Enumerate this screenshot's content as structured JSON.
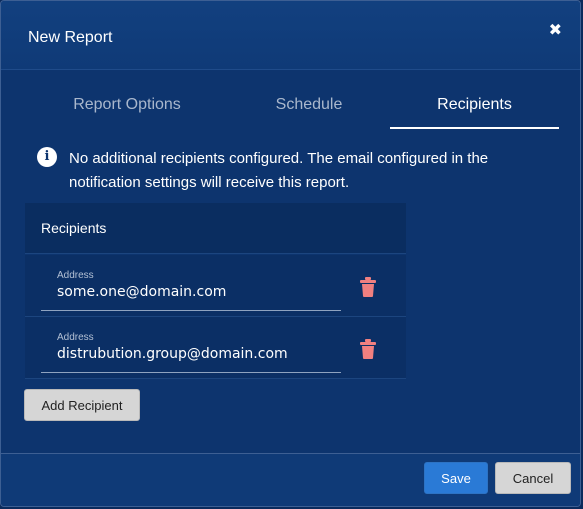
{
  "dialog": {
    "title": "New Report",
    "close_icon": "close-icon"
  },
  "tabs": [
    {
      "label": "Report Options",
      "active": false
    },
    {
      "label": "Schedule",
      "active": false
    },
    {
      "label": "Recipients",
      "active": true
    }
  ],
  "info": {
    "icon": "info-icon",
    "text": "No additional recipients configured. The email configured in the notification settings will receive this report."
  },
  "recipients_panel": {
    "header": "Recipients",
    "rows": [
      {
        "label": "Address",
        "value": "some.one@domain.com"
      },
      {
        "label": "Address",
        "value": "distrubution.group@domain.com"
      }
    ],
    "delete_icon_color": "#f08080"
  },
  "buttons": {
    "add_recipient": "Add Recipient",
    "save": "Save",
    "cancel": "Cancel"
  },
  "colors": {
    "dialog_bg": "#0d346e",
    "accent": "#2a7ad6"
  }
}
